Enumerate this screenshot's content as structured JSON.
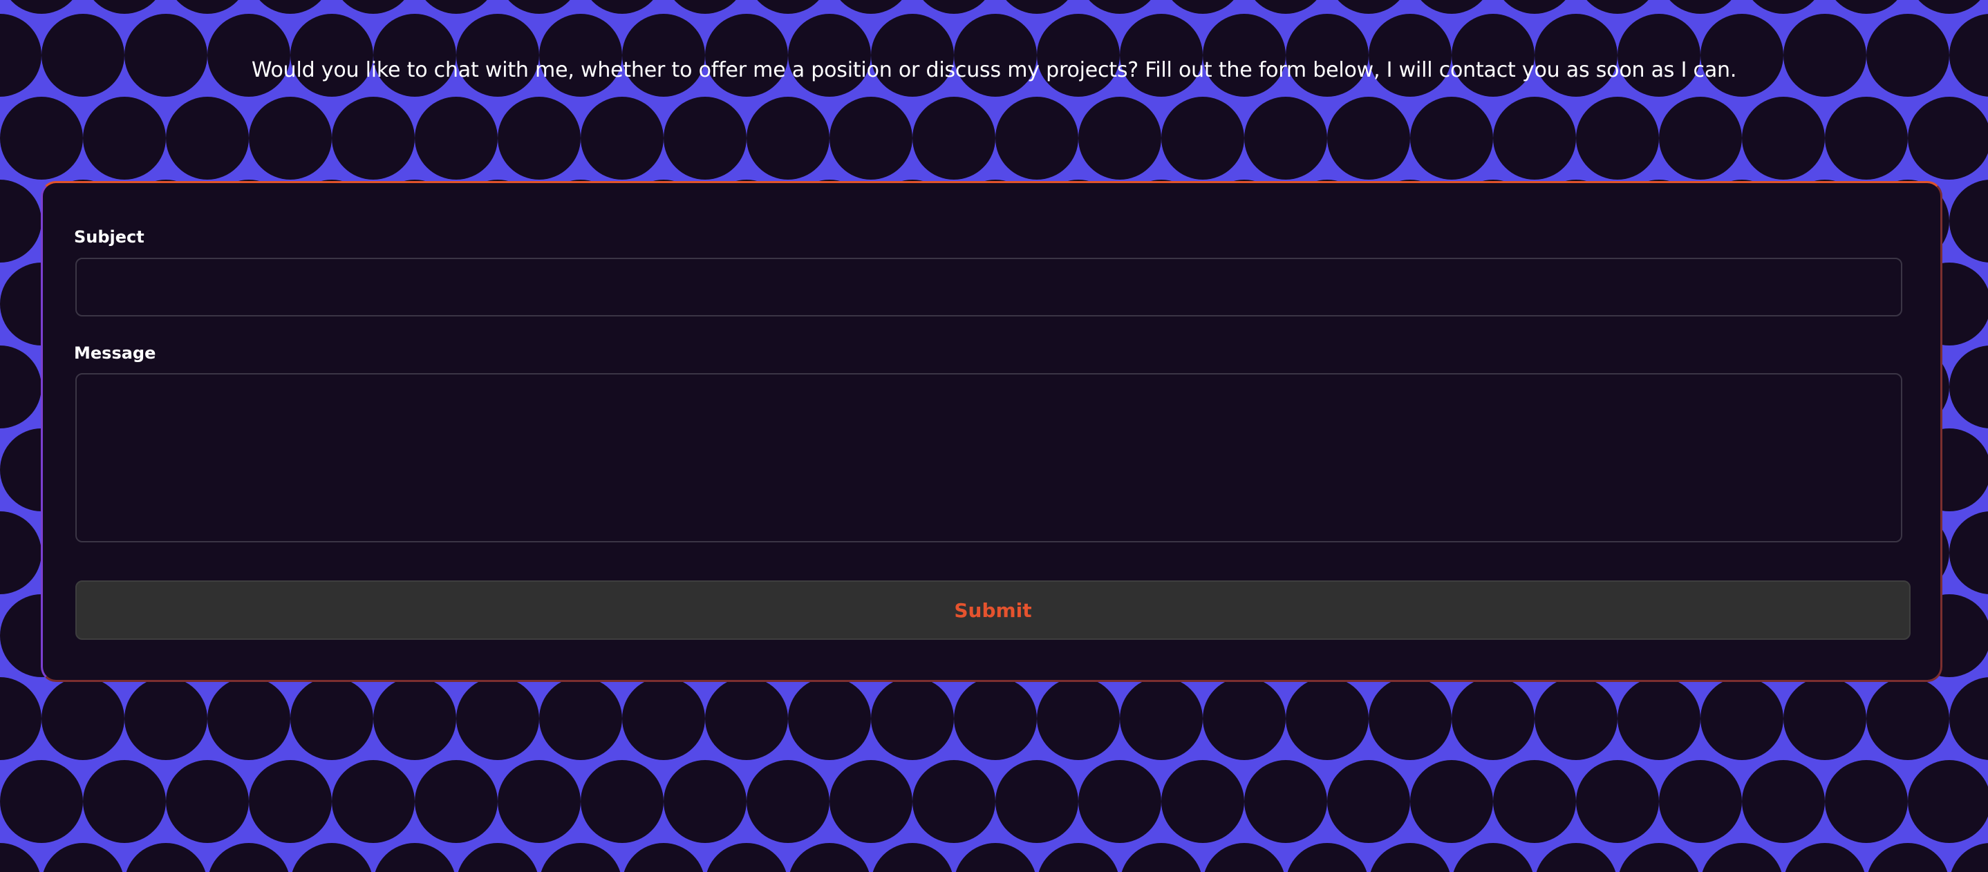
{
  "intro": {
    "text": "Would you like to chat with me, whether to offer me a position or discuss my projects? Fill out the form below, I will contact you as soon as I can."
  },
  "form": {
    "subject_label": "Subject",
    "subject_value": "",
    "message_label": "Message",
    "message_value": "",
    "submit_label": "Submit"
  },
  "theme": {
    "background_primary": "#554ae8",
    "background_secondary": "#140b1f",
    "card_background": "#140b1f",
    "accent": "#e5532e",
    "text": "#ffffff",
    "button_background": "#303030"
  },
  "background_pattern": "wave-pattern"
}
